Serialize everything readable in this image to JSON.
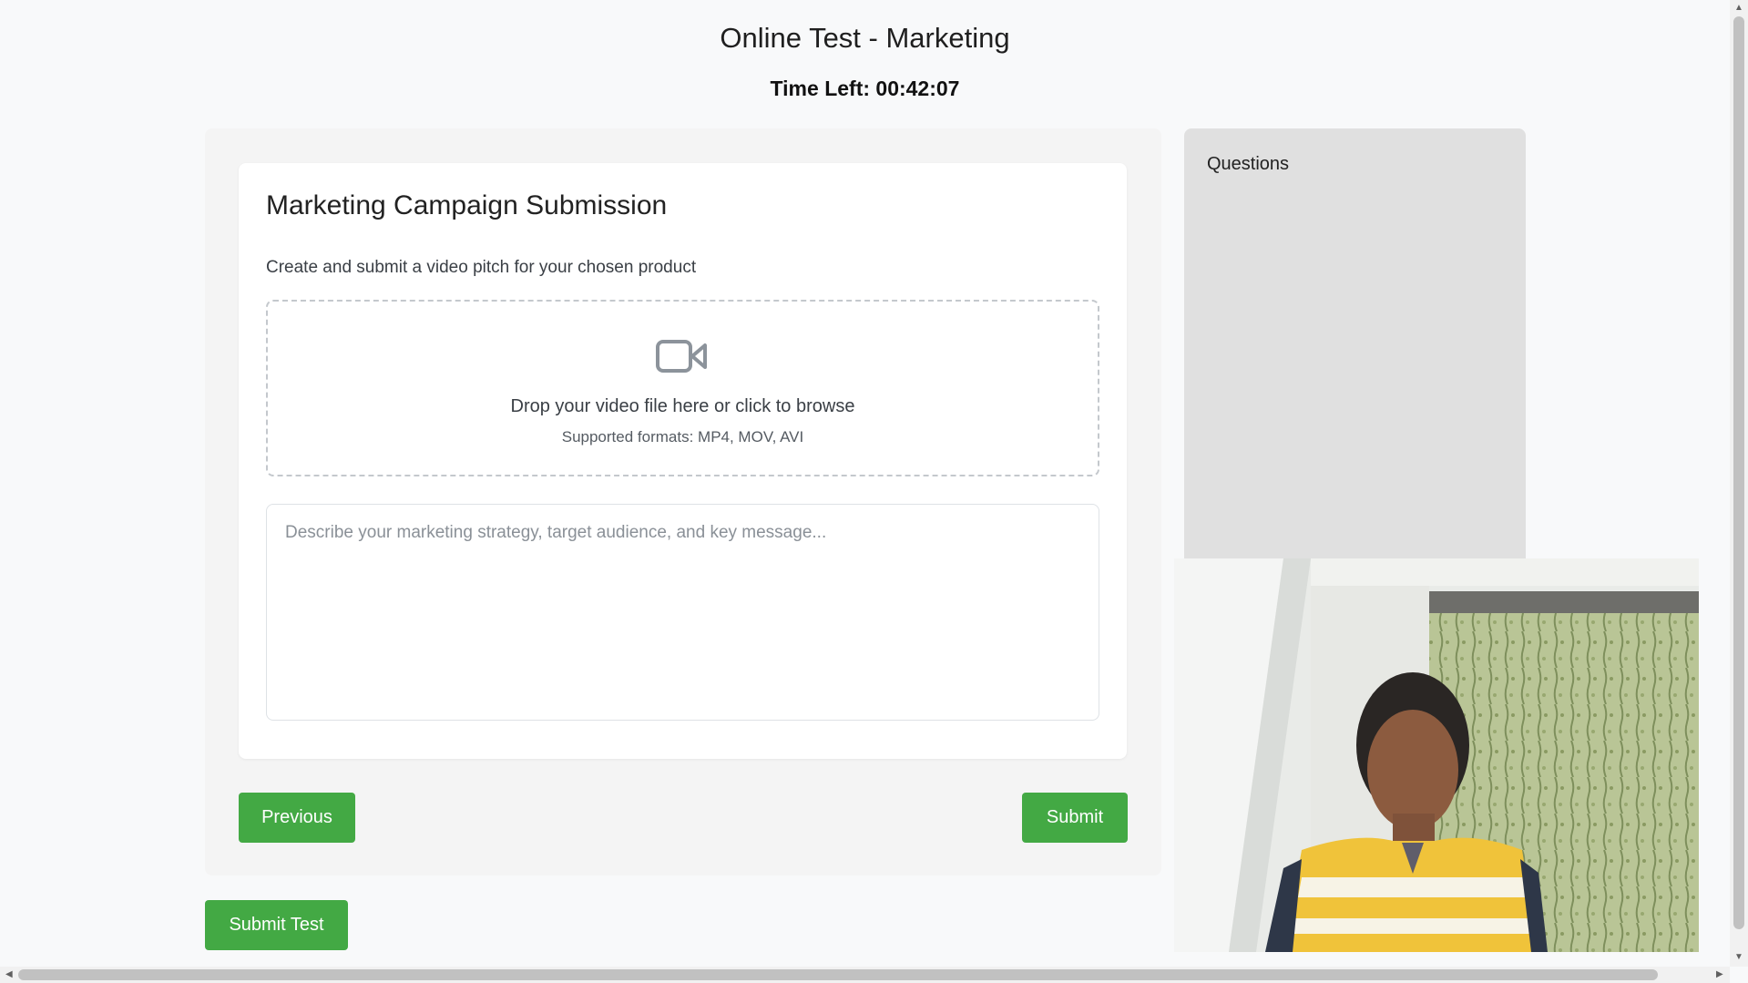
{
  "header": {
    "title": "Online Test - Marketing",
    "timer": "Time Left: 00:42:07"
  },
  "question": {
    "title": "Marketing Campaign Submission",
    "description": "Create and submit a video pitch for your chosen product",
    "dropzone": {
      "icon": "video-camera-icon",
      "text": "Drop your video file here or click to browse",
      "formats": "Supported formats: MP4, MOV, AVI"
    },
    "strategy_input": {
      "value": "",
      "placeholder": "Describe your marketing strategy, target audience, and key message..."
    }
  },
  "navigation": {
    "previous_label": "Previous",
    "submit_label": "Submit"
  },
  "footer": {
    "submit_test_label": "Submit Test"
  },
  "sidebar": {
    "title": "Questions"
  },
  "webcam": {
    "icon": "webcam-feed"
  },
  "colors": {
    "accent": "#43a944",
    "page_bg": "#f8f9fa",
    "panel_bg": "#f4f4f4",
    "sidebar_bg": "#e0e0e0"
  }
}
